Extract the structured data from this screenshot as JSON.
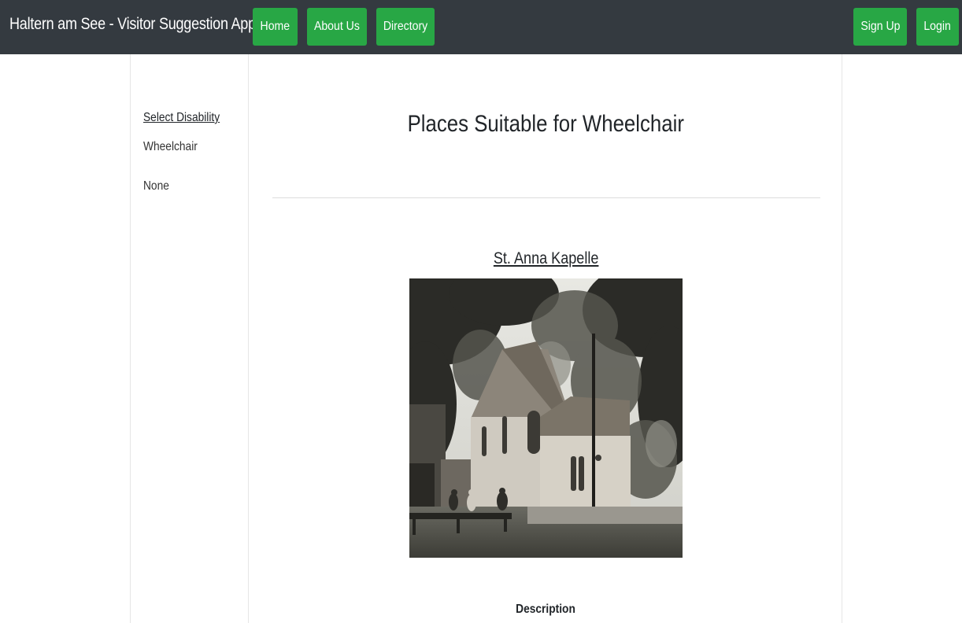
{
  "navbar": {
    "brand": "Haltern am See - Visitor Suggestion App",
    "links": [
      "Home",
      "About Us",
      "Directory"
    ],
    "auth": [
      "Sign Up",
      "Login"
    ],
    "button_color": "#28a745",
    "background_color": "#343a40"
  },
  "sidebar": {
    "heading": "Select Disability",
    "items": [
      "Wheelchair",
      "None"
    ]
  },
  "main": {
    "title": "Places Suitable for Wheelchair",
    "places": [
      {
        "name": "St. Anna Kapelle",
        "image": "black-and-white photo of a small chapel among trees",
        "description_label": "Description"
      }
    ]
  }
}
